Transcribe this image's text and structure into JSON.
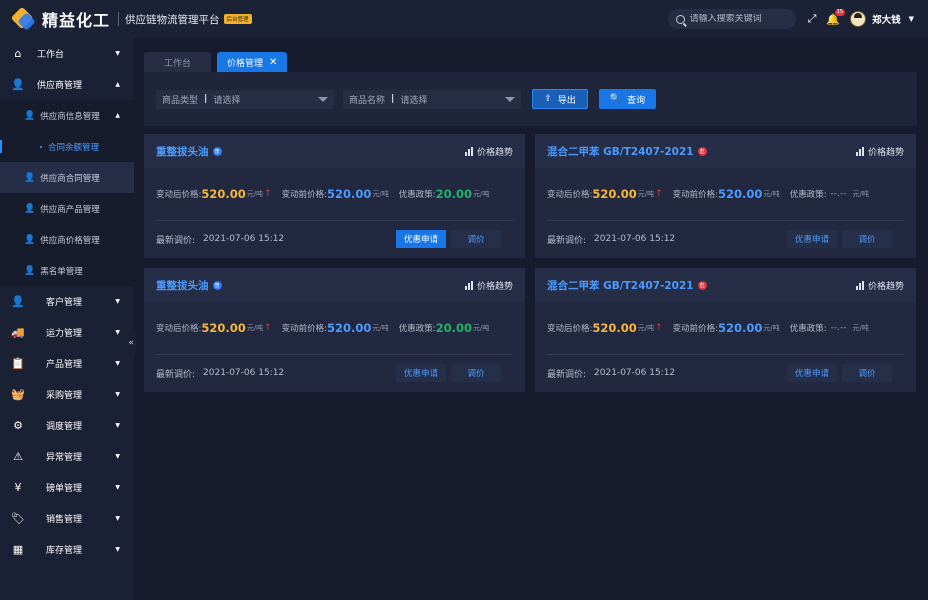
{
  "brand": {
    "name": "精益化工",
    "subtitle": "供应链物流管理平台",
    "tag": "后台管理"
  },
  "header": {
    "search_placeholder": "请输入搜索关键词",
    "notification_count": "15",
    "username": "郑大钱"
  },
  "sidebar": {
    "items": [
      {
        "label": "工作台",
        "icon": "home-icon"
      },
      {
        "label": "供应商管理",
        "icon": "user-icon",
        "expanded": true
      },
      {
        "label": "客户管理",
        "icon": "user-icon"
      },
      {
        "label": "运力管理",
        "icon": "truck-icon"
      },
      {
        "label": "产品管理",
        "icon": "clipboard-icon"
      },
      {
        "label": "采购管理",
        "icon": "basket-icon"
      },
      {
        "label": "调度管理",
        "icon": "dispatch-icon"
      },
      {
        "label": "异常管理",
        "icon": "warning-icon"
      },
      {
        "label": "磅单管理",
        "icon": "coin-icon"
      },
      {
        "label": "销售管理",
        "icon": "tag-icon"
      },
      {
        "label": "库存管理",
        "icon": "warehouse-icon"
      }
    ],
    "supplier_sub": [
      {
        "label": "供应商信息管理"
      },
      {
        "label": "合同余额管理"
      },
      {
        "label": "供应商合同管理"
      },
      {
        "label": "供应商产品管理"
      },
      {
        "label": "供应商价格管理"
      },
      {
        "label": "黑名单管理"
      }
    ]
  },
  "tabs": [
    {
      "label": "工作台"
    },
    {
      "label": "价格管理"
    }
  ],
  "filters": {
    "type_label": "商品类型",
    "type_value": "请选择",
    "name_label": "商品名称",
    "name_value": "请选择",
    "separator": "|",
    "export_label": "导出",
    "query_label": "查询"
  },
  "card_labels": {
    "trend": "价格趋势",
    "after": "变动后价格:",
    "before": "变动前价格:",
    "policy": "优惠政策:",
    "unit": "元/吨",
    "policy_none": "--.--",
    "latest": "最新调价:",
    "apply": "优惠申请",
    "adjust": "调价"
  },
  "cards": [
    {
      "title": "重整拔头油",
      "badge": "普",
      "after_price": "520.00",
      "before_price": "520.00",
      "policy": "20.00",
      "time": "2021-07-06 15:12"
    },
    {
      "title": "混合二甲苯 GB/T2407-2021",
      "badge": "危",
      "after_price": "520.00",
      "before_price": "520.00",
      "policy": "",
      "time": "2021-07-06 15:12"
    },
    {
      "title": "重整拔头油",
      "badge": "普",
      "after_price": "520.00",
      "before_price": "520.00",
      "policy": "20.00",
      "time": "2021-07-06 15:12"
    },
    {
      "title": "混合二甲苯 GB/T2407-2021",
      "badge": "危",
      "after_price": "520.00",
      "before_price": "520.00",
      "policy": "",
      "time": "2021-07-06 15:12"
    }
  ],
  "colors": {
    "accent": "#1876e6",
    "price_after": "#f6b73a",
    "price_before": "#4b9bff",
    "policy": "#21b26b",
    "danger": "#e0343e"
  }
}
